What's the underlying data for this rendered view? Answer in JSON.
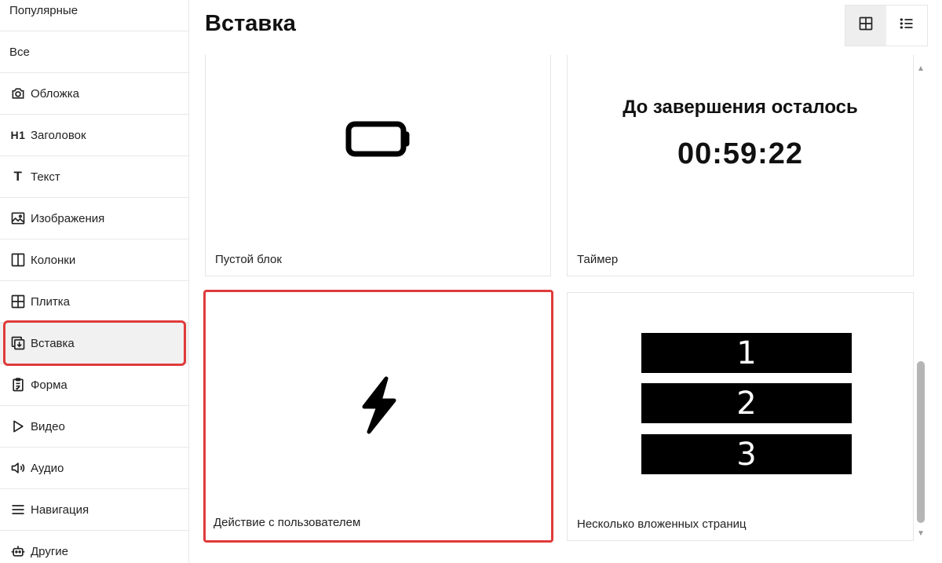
{
  "sidebar": {
    "items": [
      {
        "label": "Популярные",
        "icon": ""
      },
      {
        "label": "Все",
        "icon": ""
      },
      {
        "label": "Обложка",
        "icon": "camera-icon"
      },
      {
        "label": "Заголовок",
        "icon": "h1-icon"
      },
      {
        "label": "Текст",
        "icon": "text-icon"
      },
      {
        "label": "Изображения",
        "icon": "image-icon"
      },
      {
        "label": "Колонки",
        "icon": "columns-icon"
      },
      {
        "label": "Плитка",
        "icon": "grid-icon"
      },
      {
        "label": "Вставка",
        "icon": "insert-icon"
      },
      {
        "label": "Форма",
        "icon": "clipboard-icon"
      },
      {
        "label": "Видео",
        "icon": "play-icon"
      },
      {
        "label": "Аудио",
        "icon": "speaker-icon"
      },
      {
        "label": "Навигация",
        "icon": "menu-icon"
      },
      {
        "label": "Другие",
        "icon": "robot-icon"
      }
    ],
    "h1_glyph": "H1",
    "text_glyph": "T",
    "active": "Вставка"
  },
  "header": {
    "title": "Вставка",
    "view_modes": [
      "grid-view",
      "list-view"
    ],
    "selected_view": "grid-view"
  },
  "cards": {
    "empty_block": {
      "label": "Пустой блок",
      "icon": "battery-icon"
    },
    "timer": {
      "label": "Таймер",
      "heading": "До завершения осталось",
      "value": "00:59:22"
    },
    "user_action": {
      "label": "Действие с пользователем",
      "icon": "lightning-icon"
    },
    "nested_pages": {
      "label": "Несколько вложенных страниц",
      "pages": [
        "1",
        "2",
        "3"
      ]
    }
  },
  "colors": {
    "highlight": "#e03a3a",
    "active_bg": "#f1f1f1",
    "border": "#e6e6e6"
  }
}
